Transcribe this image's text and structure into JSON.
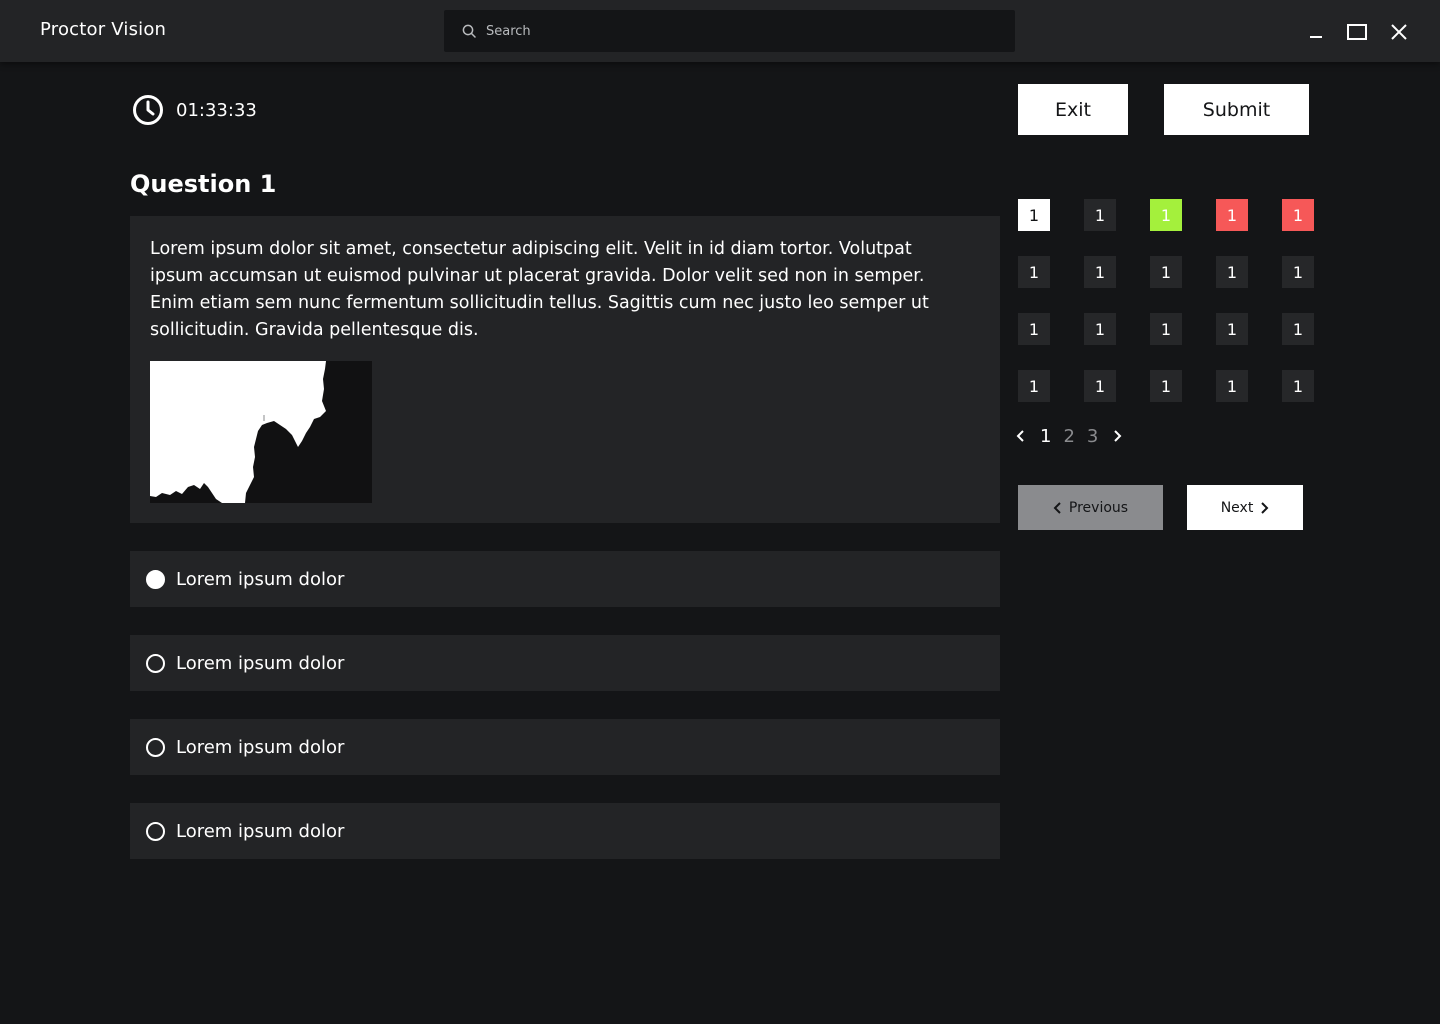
{
  "app": {
    "title": "Proctor Vision"
  },
  "search": {
    "placeholder": "Search"
  },
  "window_controls": [
    "minimize-icon",
    "maximize-icon",
    "close-icon"
  ],
  "timer": {
    "value": "01:33:33",
    "icon": "clock-icon"
  },
  "question": {
    "title": "Question 1",
    "text": "Lorem ipsum dolor sit amet, consectetur adipiscing elit. Velit in id diam tortor. Volutpat ipsum accumsan ut euismod pulvinar ut placerat gravida. Dolor velit sed non in semper. Enim etiam sem nunc fermentum sollicitudin tellus. Sagittis cum nec justo leo semper ut sollicitudin. Gravida pellentesque dis.",
    "image": "black-and-white-silhouette-image"
  },
  "options": [
    {
      "label": "Lorem ipsum dolor",
      "selected": true
    },
    {
      "label": "Lorem ipsum dolor",
      "selected": false
    },
    {
      "label": "Lorem ipsum dolor",
      "selected": false
    },
    {
      "label": "Lorem ipsum dolor",
      "selected": false
    }
  ],
  "actions": {
    "exit_label": "Exit",
    "submit_label": "Submit"
  },
  "question_grid": {
    "rows": [
      [
        {
          "label": "1",
          "status": "current"
        },
        {
          "label": "1",
          "status": "default"
        },
        {
          "label": "1",
          "status": "answered"
        },
        {
          "label": "1",
          "status": "flagged"
        },
        {
          "label": "1",
          "status": "flagged"
        }
      ],
      [
        {
          "label": "1",
          "status": "default"
        },
        {
          "label": "1",
          "status": "default"
        },
        {
          "label": "1",
          "status": "default"
        },
        {
          "label": "1",
          "status": "default"
        },
        {
          "label": "1",
          "status": "default"
        }
      ],
      [
        {
          "label": "1",
          "status": "default"
        },
        {
          "label": "1",
          "status": "default"
        },
        {
          "label": "1",
          "status": "default"
        },
        {
          "label": "1",
          "status": "default"
        },
        {
          "label": "1",
          "status": "default"
        }
      ],
      [
        {
          "label": "1",
          "status": "default"
        },
        {
          "label": "1",
          "status": "default"
        },
        {
          "label": "1",
          "status": "default"
        },
        {
          "label": "1",
          "status": "default"
        },
        {
          "label": "1",
          "status": "default"
        }
      ]
    ],
    "status_colors": {
      "current": "#ffffff",
      "default": "#262729",
      "answered": "#a4f03c",
      "flagged": "#f65858"
    }
  },
  "pagination": {
    "pages": [
      "1",
      "2",
      "3"
    ],
    "current": "1"
  },
  "navigation": {
    "previous_label": "Previous",
    "next_label": "Next"
  }
}
